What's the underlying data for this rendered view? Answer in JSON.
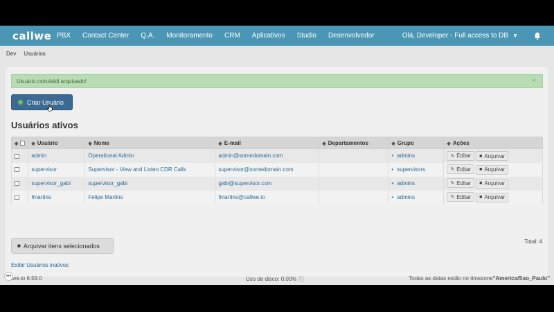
{
  "navbar": {
    "logo": "callwe",
    "items": [
      "PBX",
      "Contact Center",
      "Q.A.",
      "Monitoramento",
      "CRM",
      "Aplicativos",
      "Studio",
      "Desenvolvedor"
    ],
    "user_menu": "Olá, Developer - Full access to DB",
    "accent": "#4c96b5"
  },
  "breadcrumb": [
    "Dev",
    "Usuários"
  ],
  "alert": {
    "text": "Usuário cstrulaldi arquivado!",
    "close": "×"
  },
  "create_button": {
    "label": "Criar Usuário"
  },
  "section_title": "Usuários ativos",
  "table": {
    "headers": [
      "Usuário",
      "Nome",
      "E-mail",
      "Departamentos",
      "Grupo",
      "Ações"
    ],
    "rows": [
      {
        "user": "admin",
        "name": "Operational Admin",
        "email": "admin@somedomain.com",
        "dept": "",
        "group": "admins"
      },
      {
        "user": "supervisor",
        "name": "Supervisor - View and Listen CDR Calls",
        "email": "supervisor@somedomain.com",
        "dept": "",
        "group": "supervisors"
      },
      {
        "user": "supervisor_gabi",
        "name": "supervisor_gabi",
        "email": "gabi@supervisor.com",
        "dept": "",
        "group": "admins"
      },
      {
        "user": "fmartins",
        "name": "Felipe Martins",
        "email": "fmartins@callwe.io",
        "dept": "",
        "group": "admins"
      }
    ],
    "edit_label": "Editar",
    "archive_label": "Arquivar"
  },
  "total": "Total: 4",
  "archive_selected": {
    "label": "Arquivar itens selecionados"
  },
  "show_inactive": "Exibir Usuários inativos",
  "footer": {
    "version": "llwe.io 6.59.0",
    "disk": "Uso de disco: 0.00%",
    "timezone_prefix": "Todas as datas estão no timezone",
    "timezone": "\"America/Sao_Paulo\""
  }
}
